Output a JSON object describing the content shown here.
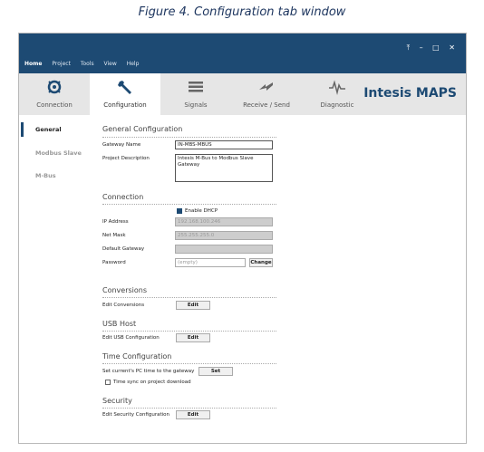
{
  "caption": "Figure 4. Configuration tab window",
  "window_controls": "⤒ – □ ✕",
  "menu": [
    "Home",
    "Project",
    "Tools",
    "View",
    "Help"
  ],
  "tabs": [
    {
      "label": "Connection",
      "icon": "connection-icon"
    },
    {
      "label": "Configuration",
      "icon": "wrench-icon"
    },
    {
      "label": "Signals",
      "icon": "list-icon"
    },
    {
      "label": "Receive / Send",
      "icon": "transfer-icon"
    },
    {
      "label": "Diagnostic",
      "icon": "pulse-icon"
    }
  ],
  "brand": "Intesis MAPS",
  "sidebar": [
    "General",
    "Modbus Slave",
    "M-Bus"
  ],
  "general": {
    "title": "General Configuration",
    "gateway_name_label": "Gateway Name",
    "gateway_name_value": "IN-MBS-MBUS",
    "project_desc_label": "Project Description",
    "project_desc_value": "Intesis M-Bus to Modbus Slave\nGateway"
  },
  "connection": {
    "title": "Connection",
    "dhcp_label": "Enable DHCP",
    "dhcp_checked": true,
    "ip_label": "IP Address",
    "ip_value": "192.168.100.246",
    "mask_label": "Net Mask",
    "mask_value": "255.255.255.0",
    "gateway_label": "Default Gateway",
    "gateway_value": "",
    "password_label": "Password",
    "password_value": "(empty)",
    "change_button": "Change"
  },
  "conversions": {
    "title": "Conversions",
    "label": "Edit Conversions",
    "button": "Edit"
  },
  "usb": {
    "title": "USB Host",
    "label": "Edit USB Configuration",
    "button": "Edit"
  },
  "time": {
    "title": "Time Configuration",
    "label": "Set current's PC time to the gateway",
    "button": "Set",
    "sync_label": "Time sync on project download",
    "sync_checked": false
  },
  "security": {
    "title": "Security",
    "label": "Edit Security Configuration",
    "button": "Edit"
  },
  "colors": {
    "titlebar": "#1d4a73",
    "tabsbar": "#e6e6e6",
    "accent": "#1d4a73"
  }
}
